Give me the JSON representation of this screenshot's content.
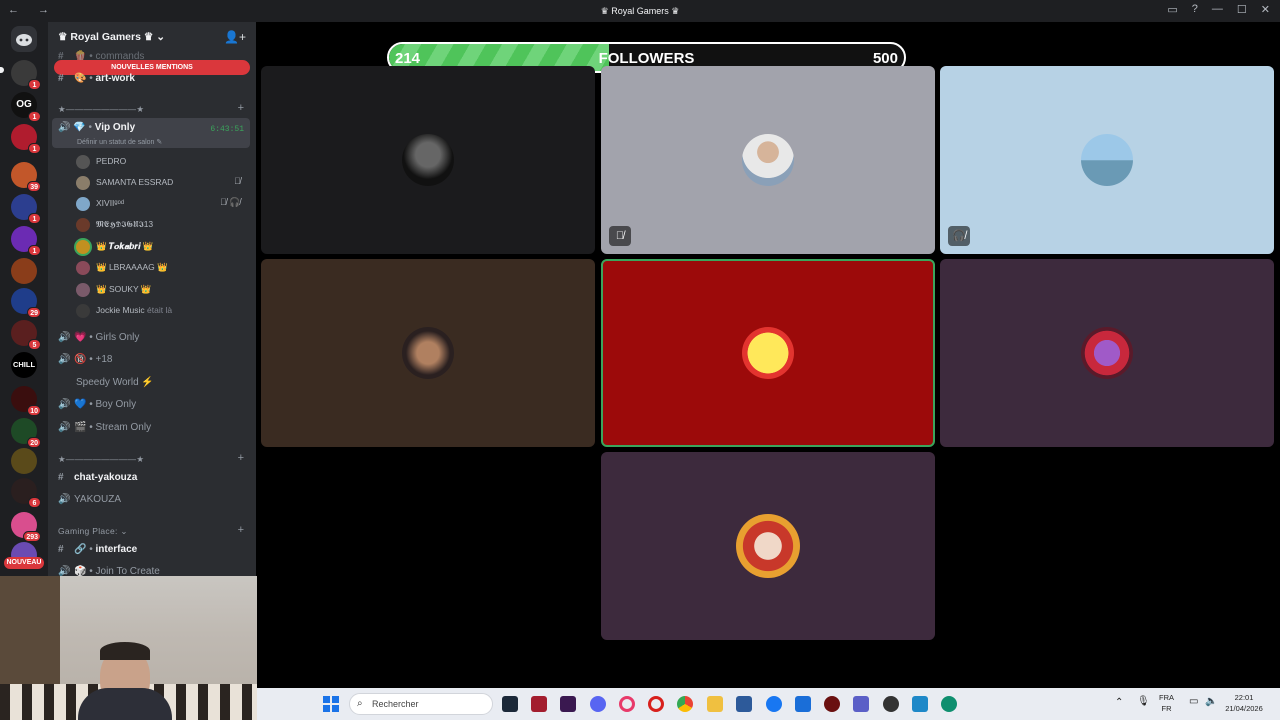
{
  "window": {
    "title": "♛ Royal Gamers ♛"
  },
  "server": {
    "name": "♛ Royal Gamers ♛"
  },
  "sidebar": {
    "mentions_banner": "NOUVELLES MENTIONS",
    "partial_top": "commands",
    "art_work": "art-work",
    "category1": "★————————★",
    "vip": {
      "name": "Vip Only",
      "timer": "6:43:51",
      "status": "Définir un statut de salon"
    },
    "members": [
      "PEDRO",
      "SAMANTA ESSRAD",
      "XIVIIᵍᵒᵈ",
      "𝕸𝕰𝕳𝕯𝕴𝕲𝖀𝕴13",
      "𝑻𝒐𝒌𝒂𝒃𝒓𝒊",
      "LBRAAAAG",
      "SOUKY",
      "Jockie Music"
    ],
    "jockie_suffix": "était là",
    "voice": [
      "Girls Only",
      "+18",
      "Speedy World",
      "Boy Only",
      "Stream Only"
    ],
    "category2": "★————————★",
    "chat_yakouza": "chat-yakouza",
    "yakouza": "YAKOUZA",
    "gaming_place": "Gaming Place:",
    "interface": "interface",
    "join_to_create": "Join To Create"
  },
  "server_badges": [
    "1",
    "1",
    "1",
    "39",
    "1",
    "1",
    "29",
    "5",
    "CHILL",
    "10",
    "20",
    "6",
    "293",
    "NOUVEAU"
  ],
  "followers": {
    "current": "214",
    "label": "FOLLOWERS",
    "goal": "500",
    "progress": 0.428
  },
  "taskbar": {
    "search_placeholder": "Rechercher",
    "lang_top": "FRA",
    "lang_bottom": "FR",
    "time": "22:01",
    "date": "21/04/2026"
  },
  "colors": {
    "accent": "#5865f2",
    "badge": "#da373c",
    "progress": "#4fc45a",
    "speaking": "#3ba55c"
  }
}
